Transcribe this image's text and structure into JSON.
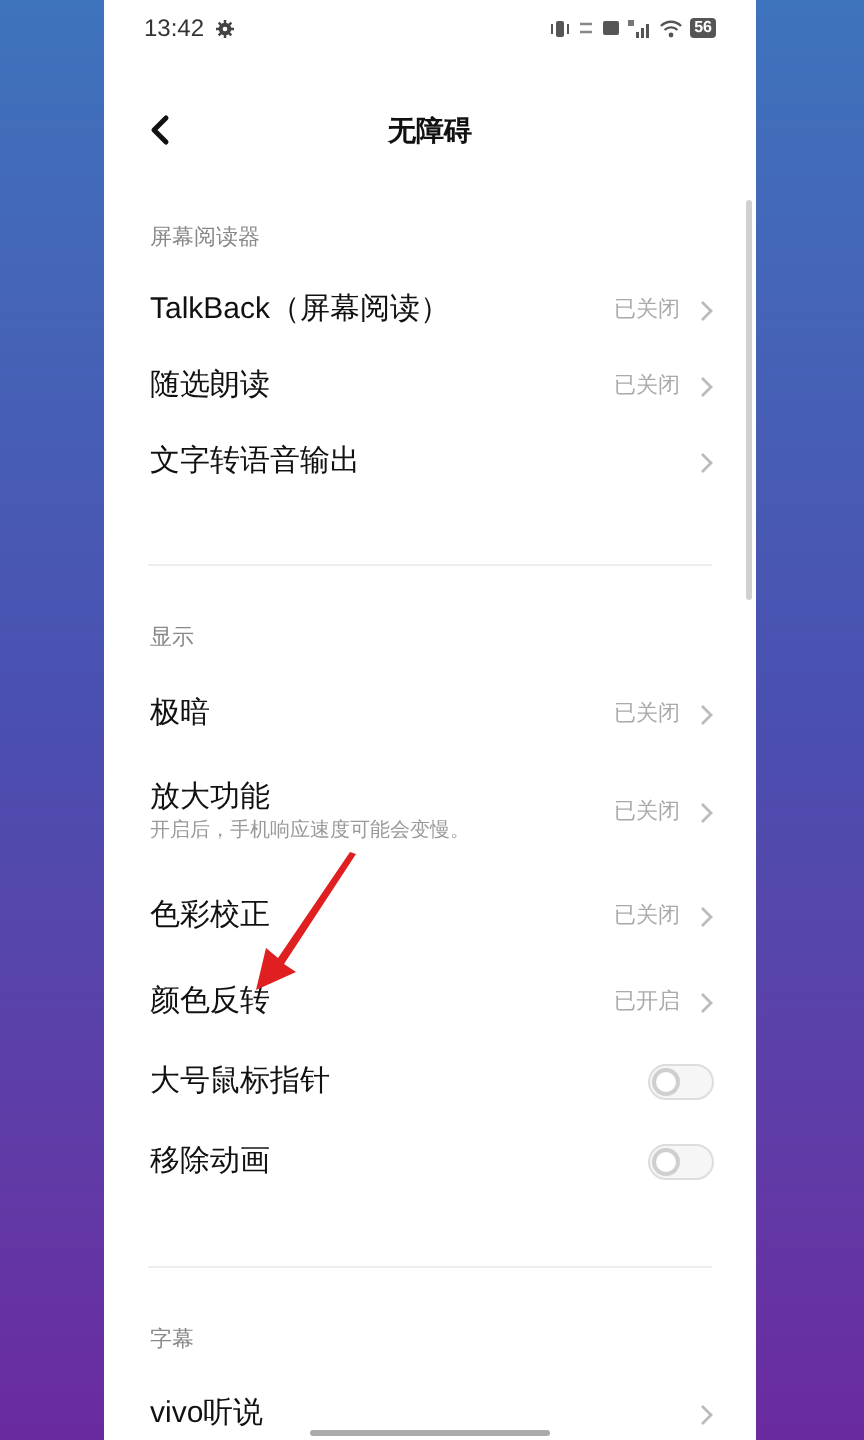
{
  "status_bar": {
    "time": "13:42",
    "battery": "56"
  },
  "header": {
    "title": "无障碍"
  },
  "sections": [
    {
      "title": "屏幕阅读器",
      "items": [
        {
          "kind": "link",
          "label": "TalkBack（屏幕阅读）",
          "value": "已关闭"
        },
        {
          "kind": "link",
          "label": "随选朗读",
          "value": "已关闭"
        },
        {
          "kind": "link",
          "label": "文字转语音输出"
        }
      ]
    },
    {
      "title": "显示",
      "items": [
        {
          "kind": "link",
          "label": "极暗",
          "value": "已关闭"
        },
        {
          "kind": "link",
          "label": "放大功能",
          "subtitle": "开启后，手机响应速度可能会变慢。",
          "value": "已关闭"
        },
        {
          "kind": "link",
          "label": "色彩校正",
          "value": "已关闭"
        },
        {
          "kind": "link",
          "label": "颜色反转",
          "value": "已开启"
        },
        {
          "kind": "toggle",
          "label": "大号鼠标指针",
          "on": false
        },
        {
          "kind": "toggle",
          "label": "移除动画",
          "on": false
        }
      ]
    },
    {
      "title": "字幕",
      "items": [
        {
          "kind": "link",
          "label": "vivo听说"
        }
      ]
    }
  ]
}
